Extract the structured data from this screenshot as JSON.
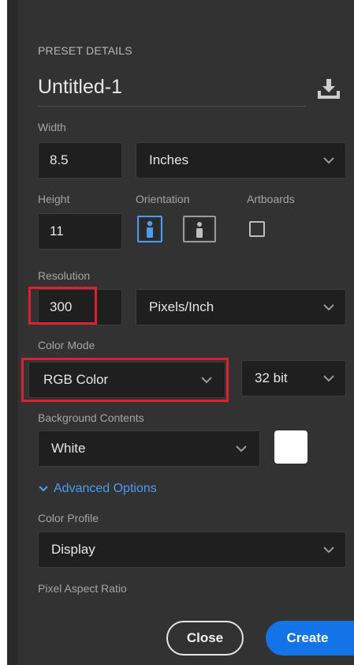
{
  "panel": {
    "section_title": "PRESET DETAILS",
    "document_name": "Untitled-1",
    "width": {
      "label": "Width",
      "value": "8.5",
      "unit": "Inches"
    },
    "height": {
      "label": "Height",
      "value": "11"
    },
    "orientation": {
      "label": "Orientation",
      "selected": "portrait"
    },
    "artboards": {
      "label": "Artboards",
      "checked": false
    },
    "resolution": {
      "label": "Resolution",
      "value": "300",
      "unit": "Pixels/Inch"
    },
    "color_mode": {
      "label": "Color Mode",
      "mode": "RGB Color",
      "bit_depth": "32 bit"
    },
    "background": {
      "label": "Background Contents",
      "value": "White",
      "swatch_color": "#ffffff"
    },
    "advanced": {
      "label": "Advanced Options"
    },
    "color_profile": {
      "label": "Color Profile",
      "value": "Display"
    },
    "pixel_aspect": {
      "label": "Pixel Aspect Ratio"
    }
  },
  "buttons": {
    "close": "Close",
    "create": "Create"
  },
  "colors": {
    "accent": "#1473e6",
    "highlight": "#e0202e",
    "panel_bg": "#323232"
  },
  "icons": [
    "save-preset-icon",
    "portrait-orientation-icon",
    "landscape-orientation-icon",
    "chevron-down-icon"
  ]
}
